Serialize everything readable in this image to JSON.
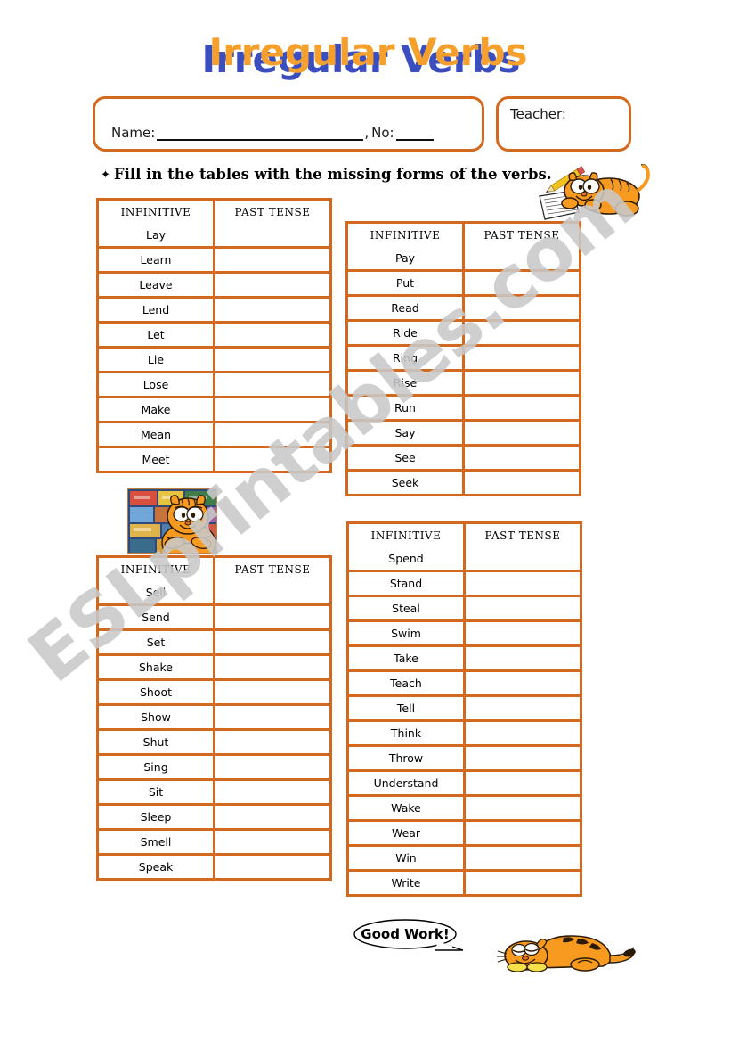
{
  "title": {
    "text": "Irregular Verbs",
    "color_orange": "#f5a02c",
    "color_blue": "#3a4ec0"
  },
  "header": {
    "name_label": "Name:",
    "comma": ",",
    "no_label": "No:",
    "teacher_label": "Teacher:"
  },
  "instruction": {
    "bullet": "✦",
    "text": "Fill in the tables with the missing forms of the verbs."
  },
  "columns": {
    "infinitive": "INFINITIVE",
    "past_tense": "PAST TENSE"
  },
  "tables": [
    {
      "id": "table1",
      "headers": [
        "INFINITIVE",
        "PAST TENSE"
      ],
      "rows": [
        {
          "infinitive": "Lay",
          "past_tense": ""
        },
        {
          "infinitive": "Learn",
          "past_tense": ""
        },
        {
          "infinitive": "Leave",
          "past_tense": ""
        },
        {
          "infinitive": "Lend",
          "past_tense": ""
        },
        {
          "infinitive": "Let",
          "past_tense": ""
        },
        {
          "infinitive": "Lie",
          "past_tense": ""
        },
        {
          "infinitive": "Lose",
          "past_tense": ""
        },
        {
          "infinitive": "Make",
          "past_tense": ""
        },
        {
          "infinitive": "Mean",
          "past_tense": ""
        },
        {
          "infinitive": "Meet",
          "past_tense": ""
        }
      ]
    },
    {
      "id": "table2",
      "headers": [
        "INFINITIVE",
        "PAST TENSE"
      ],
      "rows": [
        {
          "infinitive": "Pay",
          "past_tense": ""
        },
        {
          "infinitive": "Put",
          "past_tense": ""
        },
        {
          "infinitive": "Read",
          "past_tense": ""
        },
        {
          "infinitive": "Ride",
          "past_tense": ""
        },
        {
          "infinitive": "Ring",
          "past_tense": ""
        },
        {
          "infinitive": "Rise",
          "past_tense": ""
        },
        {
          "infinitive": "Run",
          "past_tense": ""
        },
        {
          "infinitive": "Say",
          "past_tense": ""
        },
        {
          "infinitive": "See",
          "past_tense": ""
        },
        {
          "infinitive": "Seek",
          "past_tense": ""
        }
      ]
    },
    {
      "id": "table3",
      "headers": [
        "INFINITIVE",
        "PAST TENSE"
      ],
      "rows": [
        {
          "infinitive": "Sell",
          "past_tense": ""
        },
        {
          "infinitive": "Send",
          "past_tense": ""
        },
        {
          "infinitive": "Set",
          "past_tense": ""
        },
        {
          "infinitive": "Shake",
          "past_tense": ""
        },
        {
          "infinitive": "Shoot",
          "past_tense": ""
        },
        {
          "infinitive": "Show",
          "past_tense": ""
        },
        {
          "infinitive": "Shut",
          "past_tense": ""
        },
        {
          "infinitive": "Sing",
          "past_tense": ""
        },
        {
          "infinitive": "Sit",
          "past_tense": ""
        },
        {
          "infinitive": "Sleep",
          "past_tense": ""
        },
        {
          "infinitive": "Smell",
          "past_tense": ""
        },
        {
          "infinitive": "Speak",
          "past_tense": ""
        }
      ]
    },
    {
      "id": "table4",
      "headers": [
        "INFINITIVE",
        "PAST TENSE"
      ],
      "rows": [
        {
          "infinitive": "Spend",
          "past_tense": ""
        },
        {
          "infinitive": "Stand",
          "past_tense": ""
        },
        {
          "infinitive": "Steal",
          "past_tense": ""
        },
        {
          "infinitive": "Swim",
          "past_tense": ""
        },
        {
          "infinitive": "Take",
          "past_tense": ""
        },
        {
          "infinitive": "Teach",
          "past_tense": ""
        },
        {
          "infinitive": "Tell",
          "past_tense": ""
        },
        {
          "infinitive": "Think",
          "past_tense": ""
        },
        {
          "infinitive": "Throw",
          "past_tense": ""
        },
        {
          "infinitive": "Understand",
          "past_tense": ""
        },
        {
          "infinitive": "Wake",
          "past_tense": ""
        },
        {
          "infinitive": "Wear",
          "past_tense": ""
        },
        {
          "infinitive": "Win",
          "past_tense": ""
        },
        {
          "infinitive": "Write",
          "past_tense": ""
        }
      ]
    }
  ],
  "footer": {
    "good_work": "Good Work!"
  },
  "watermark": {
    "text": "ESLprintables.com",
    "color": "#c9c9c9"
  },
  "theme": {
    "border_orange": "#d2691e",
    "page_background": "#ffffff"
  }
}
